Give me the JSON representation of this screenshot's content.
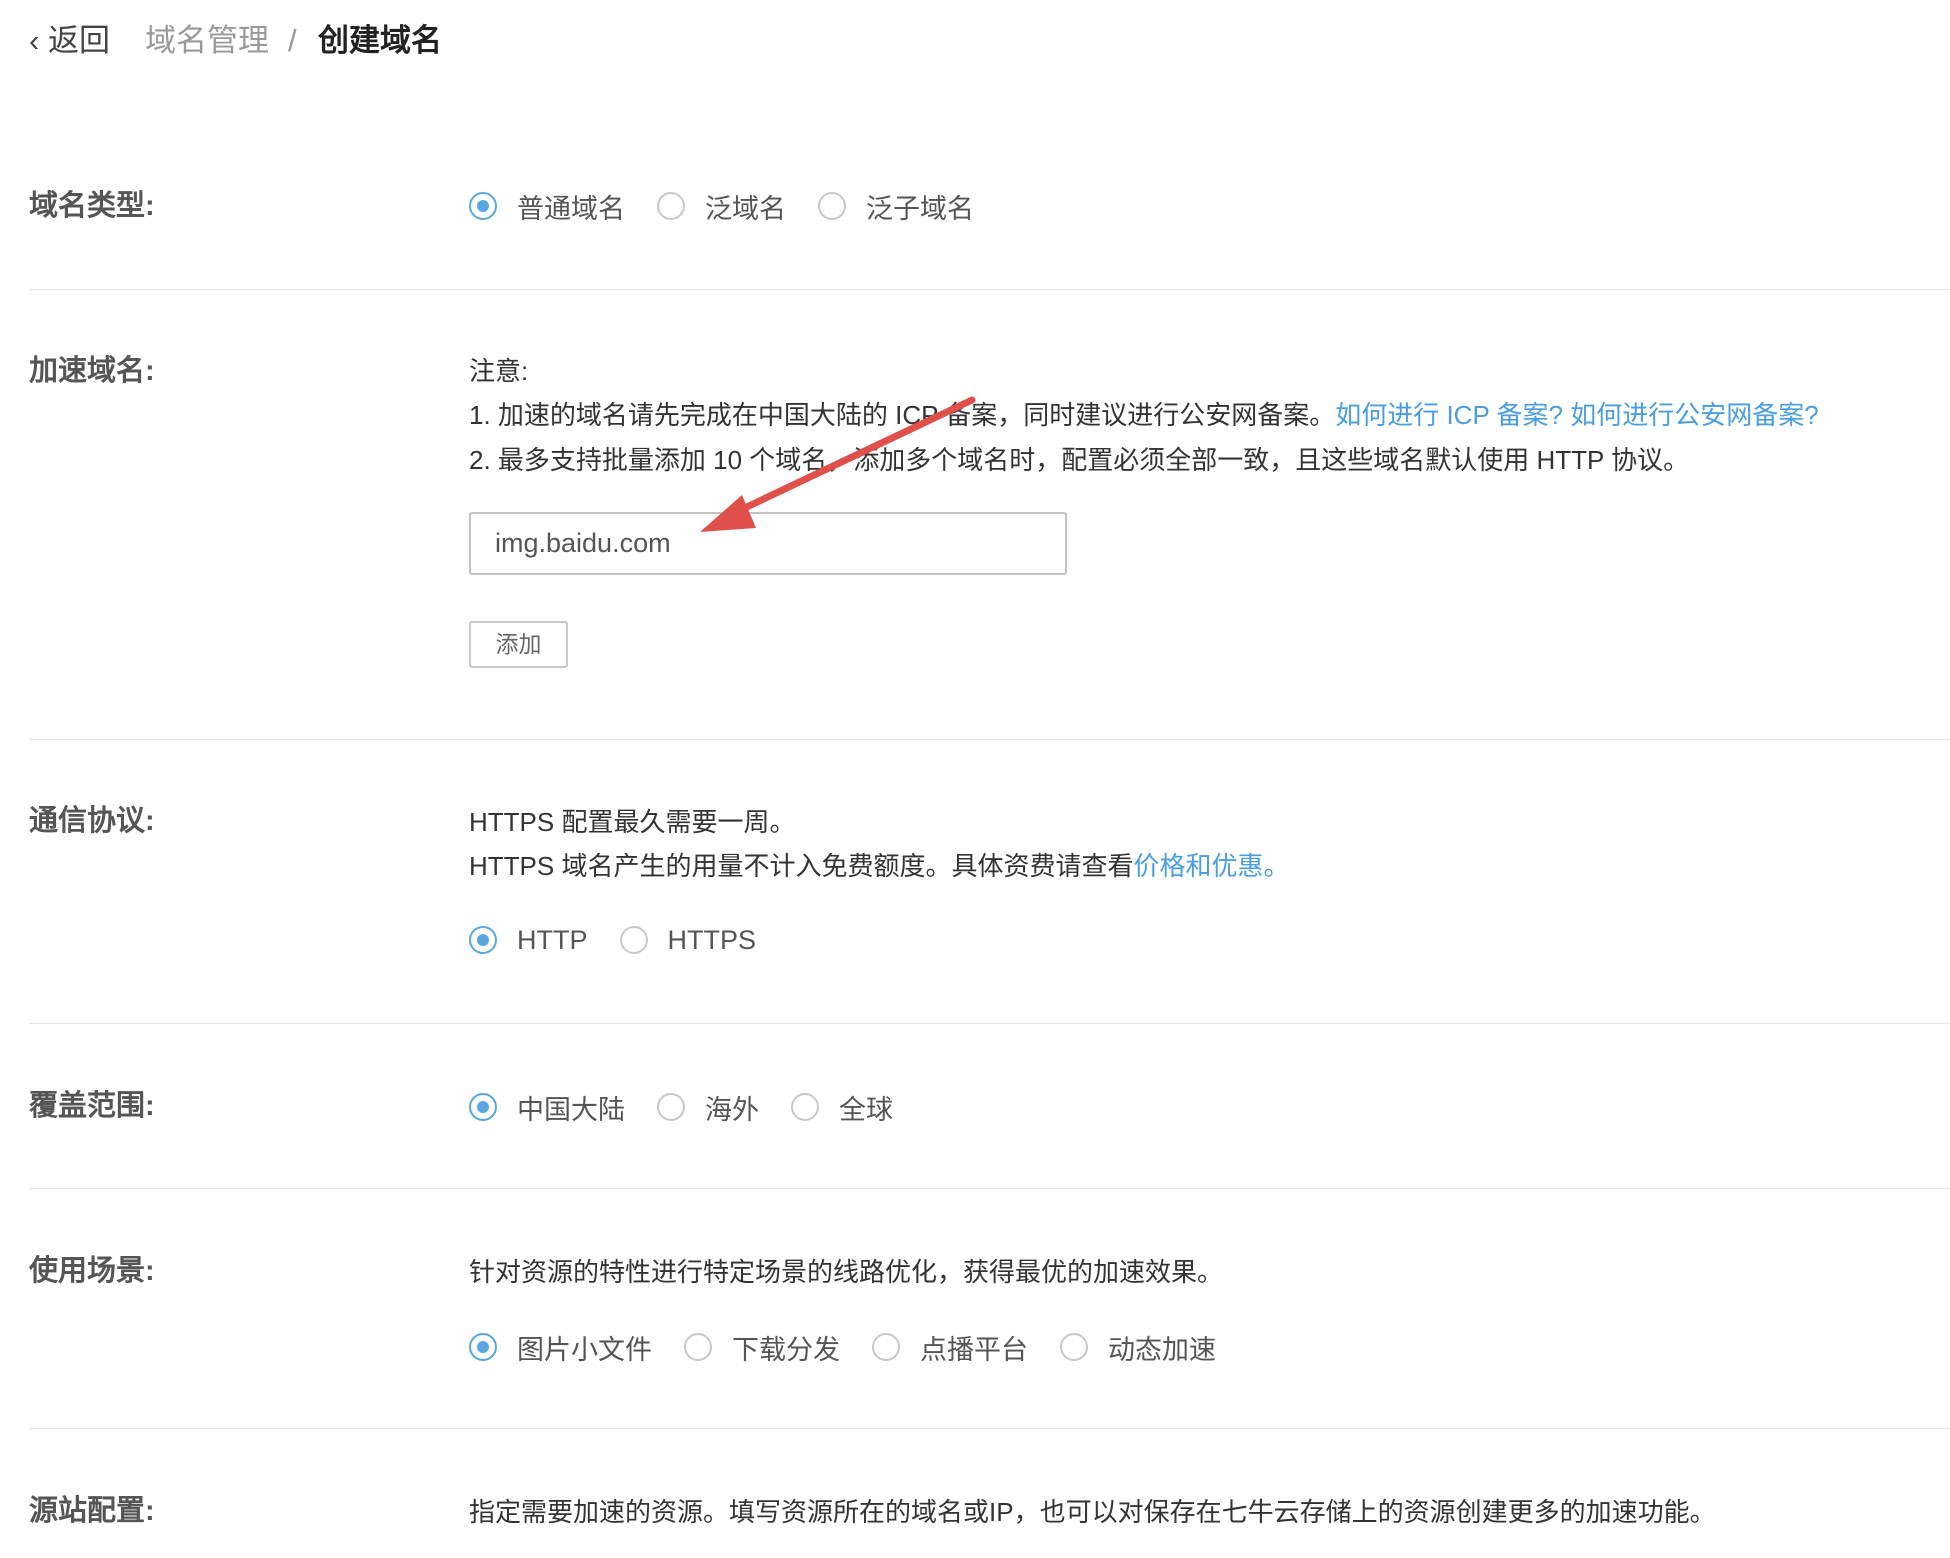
{
  "breadcrumb": {
    "back": "返回",
    "parent": "域名管理",
    "separator": "/",
    "current": "创建域名"
  },
  "domain_type": {
    "label": "域名类型:",
    "options": [
      "普通域名",
      "泛域名",
      "泛子域名"
    ],
    "selected": 0
  },
  "accel_domain": {
    "label": "加速域名:",
    "note_title": "注意:",
    "note1": "1. 加速的域名请先完成在中国大陆的 ICP 备案，同时建议进行公安网备案。",
    "link_icp": "如何进行 ICP 备案?",
    "link_police": "如何进行公安网备案?",
    "note2": "2. 最多支持批量添加 10 个域名，添加多个域名时，配置必须全部一致，且这些域名默认使用 HTTP 协议。",
    "input_value": "img.baidu.com",
    "add_button": "添加"
  },
  "protocol": {
    "label": "通信协议:",
    "line1": "HTTPS 配置最久需要一周。",
    "line2": "HTTPS 域名产生的用量不计入免费额度。具体资费请查看",
    "link": "价格和优惠。",
    "options": [
      "HTTP",
      "HTTPS"
    ],
    "selected": 0
  },
  "coverage": {
    "label": "覆盖范围:",
    "options": [
      "中国大陆",
      "海外",
      "全球"
    ],
    "selected": 0
  },
  "scenario": {
    "label": "使用场景:",
    "desc": "针对资源的特性进行特定场景的线路优化，获得最优的加速效果。",
    "options": [
      "图片小文件",
      "下载分发",
      "点播平台",
      "动态加速"
    ],
    "selected": 0
  },
  "origin": {
    "label": "源站配置:",
    "desc": "指定需要加速的资源。填写资源所在的域名或IP，也可以对保存在七牛云存储上的资源创建更多的加速功能。"
  },
  "colors": {
    "accent": "#5aa6e0",
    "link": "#4a9ee0",
    "arrow": "#e0504a"
  }
}
